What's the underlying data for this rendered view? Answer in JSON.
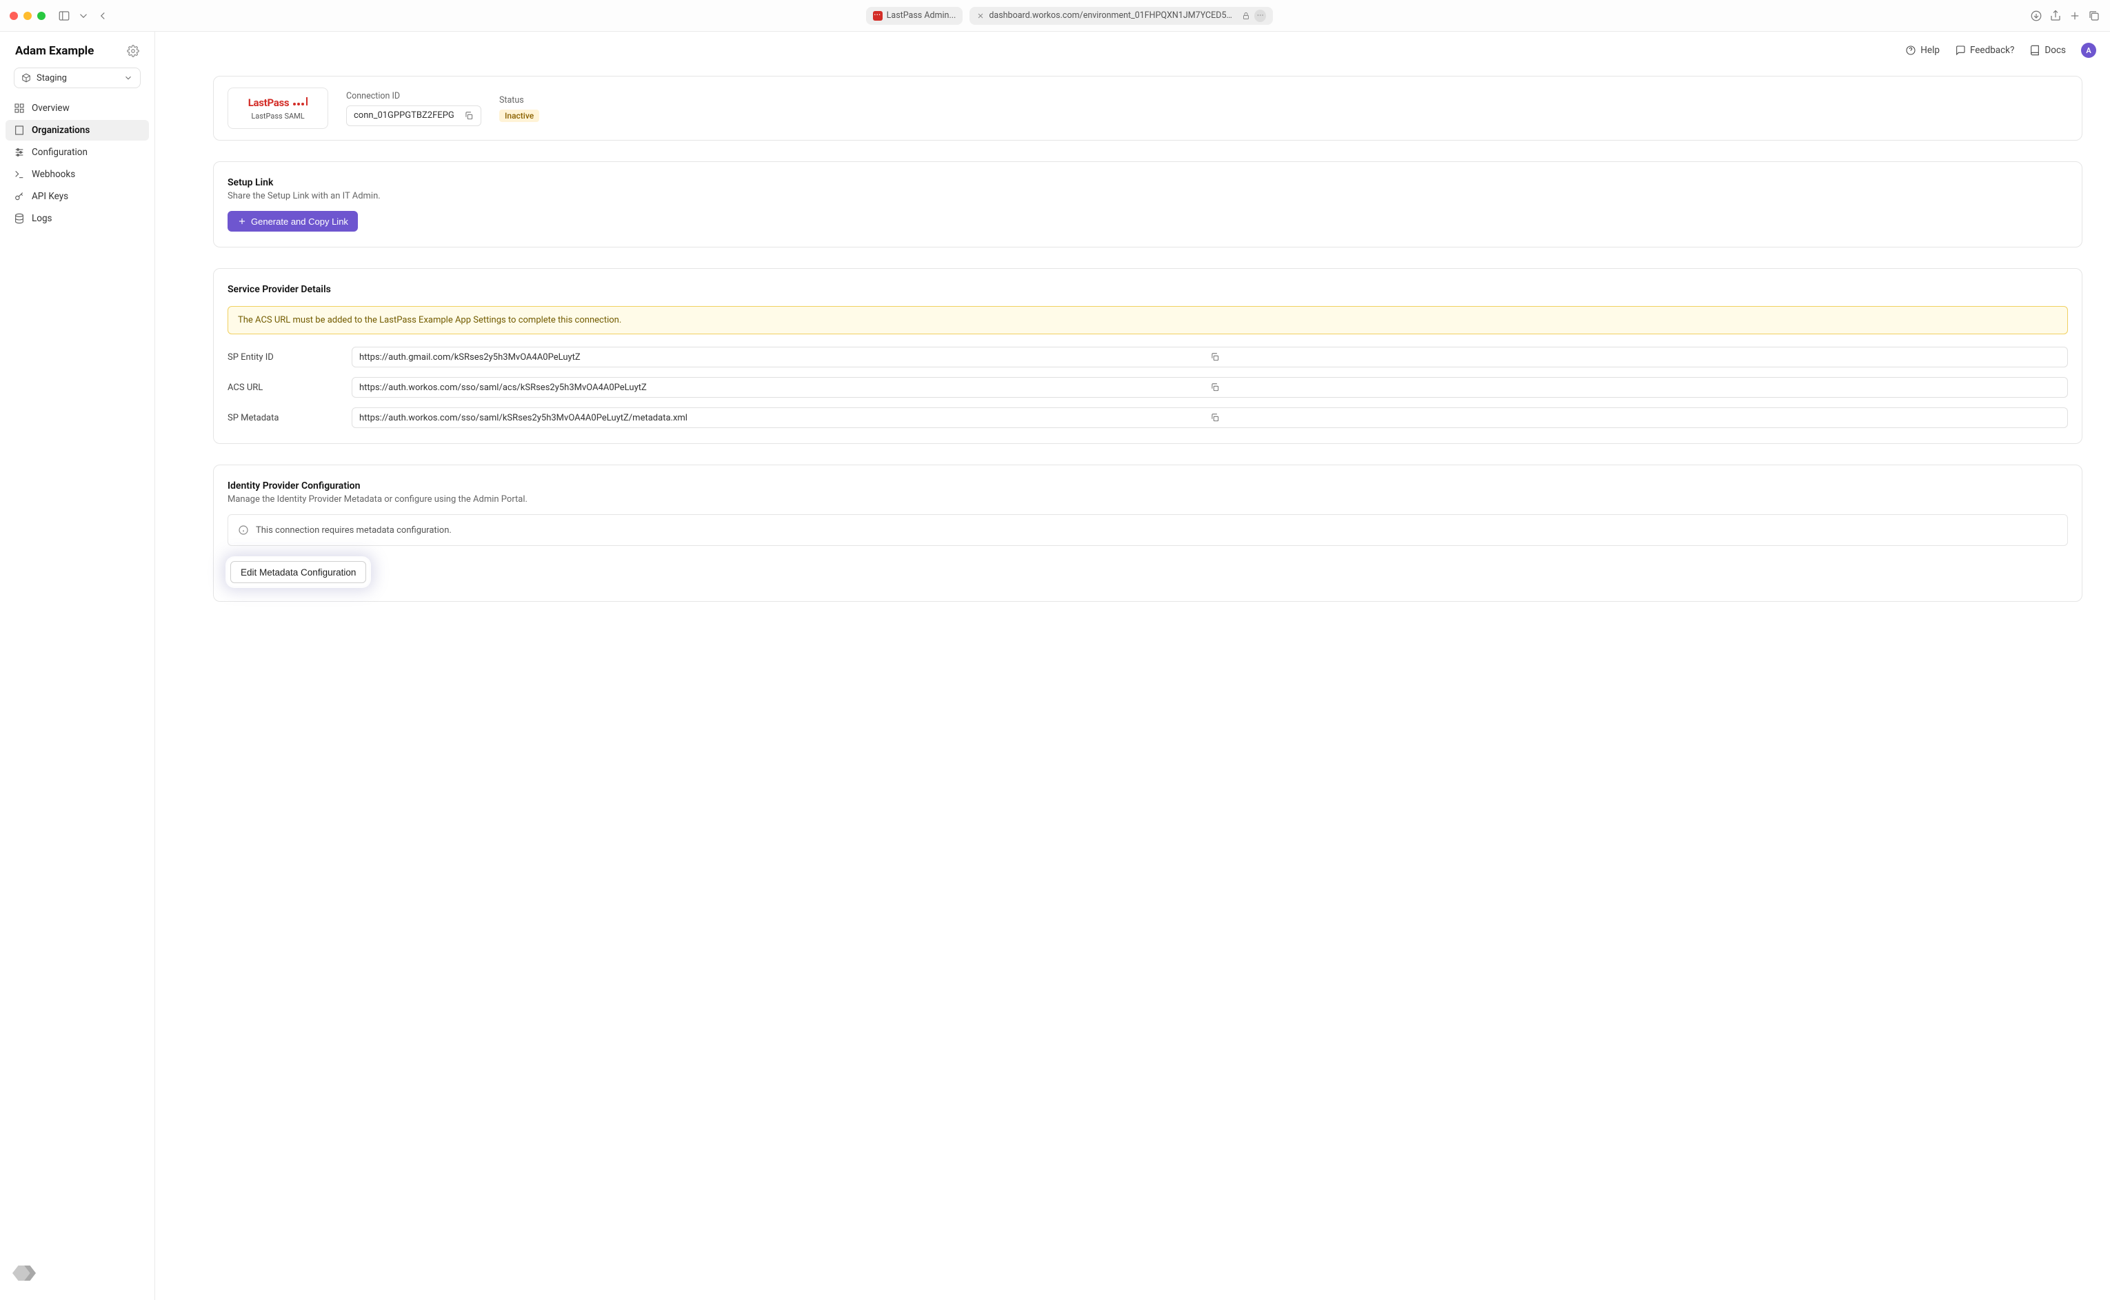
{
  "chrome": {
    "tab_label": "LastPass Admin...",
    "address": "dashboard.workos.com/environment_01FHPQXN1JM7YCED5EXY..."
  },
  "workspace": {
    "name": "Adam Example",
    "environment": "Staging"
  },
  "nav": {
    "overview": "Overview",
    "organizations": "Organizations",
    "configuration": "Configuration",
    "webhooks": "Webhooks",
    "api_keys": "API Keys",
    "logs": "Logs"
  },
  "header": {
    "help": "Help",
    "feedback": "Feedback?",
    "docs": "Docs",
    "avatar_initial": "A"
  },
  "connection": {
    "provider_name": "LastPass SAML",
    "id_label": "Connection ID",
    "id_value": "conn_01GPPGTBZ2FEPG",
    "status_label": "Status",
    "status_value": "Inactive"
  },
  "setup_link": {
    "title": "Setup Link",
    "description": "Share the Setup Link with an IT Admin.",
    "button": "Generate and Copy Link"
  },
  "sp_details": {
    "title": "Service Provider Details",
    "alert": "The ACS URL must be added to the LastPass Example App Settings to complete this connection.",
    "entity_id_label": "SP Entity ID",
    "entity_id_value": "https://auth.gmail.com/kSRses2y5h3MvOA4A0PeLuytZ",
    "acs_label": "ACS URL",
    "acs_value": "https://auth.workos.com/sso/saml/acs/kSRses2y5h3MvOA4A0PeLuytZ",
    "metadata_label": "SP Metadata",
    "metadata_value": "https://auth.workos.com/sso/saml/kSRses2y5h3MvOA4A0PeLuytZ/metadata.xml"
  },
  "idp_config": {
    "title": "Identity Provider Configuration",
    "description": "Manage the Identity Provider Metadata or configure using the Admin Portal.",
    "info": "This connection requires metadata configuration.",
    "edit_button": "Edit Metadata Configuration"
  }
}
